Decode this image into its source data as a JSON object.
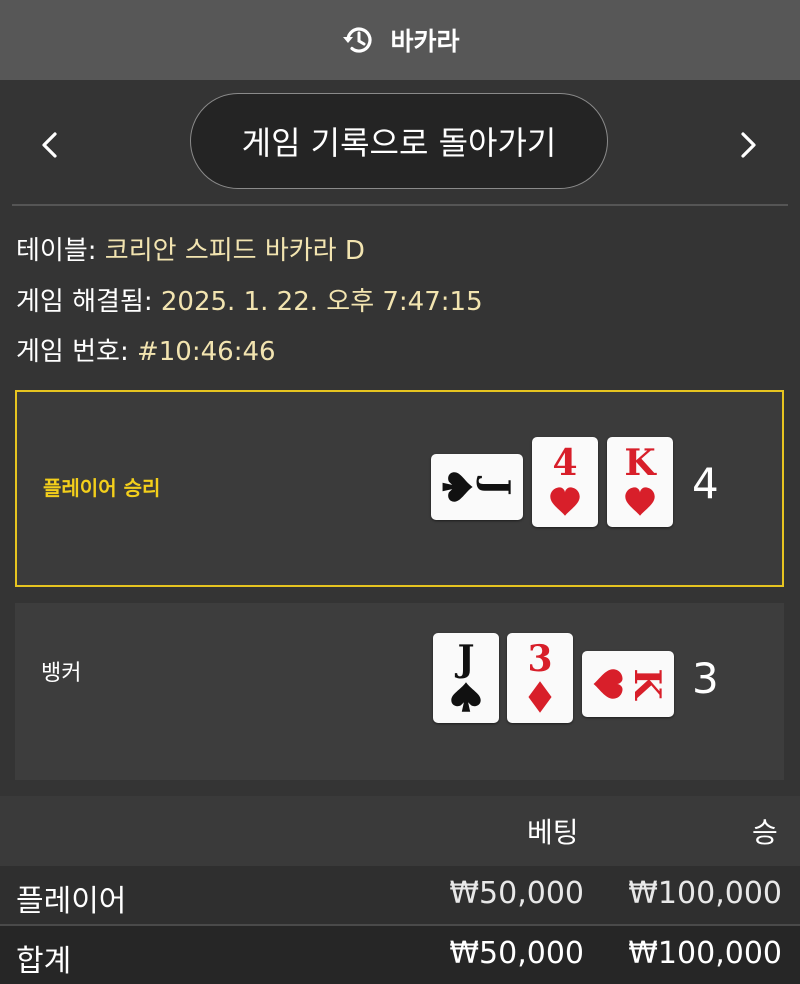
{
  "header": {
    "title": "바카라",
    "icon": "history-icon"
  },
  "nav": {
    "prev_icon": "chevron-left-icon",
    "next_icon": "chevron-right-icon",
    "back_label": "게임 기록으로 돌아가기"
  },
  "info": {
    "table_label": "테이블:",
    "table_value": "코리안 스피드 바카라 D",
    "resolved_label": "게임 해결됨:",
    "resolved_value": "2025. 1. 22. 오후 7:47:15",
    "number_label": "게임 번호:",
    "number_value": "#10:46:46"
  },
  "player": {
    "label": "플레이어 승리",
    "score": "4",
    "cards": [
      {
        "rank": "J",
        "suit": "spade",
        "sideways": true
      },
      {
        "rank": "4",
        "suit": "heart",
        "sideways": false
      },
      {
        "rank": "K",
        "suit": "heart",
        "sideways": false
      }
    ]
  },
  "banker": {
    "label": "뱅커",
    "score": "3",
    "cards": [
      {
        "rank": "J",
        "suit": "spade",
        "sideways": false
      },
      {
        "rank": "3",
        "suit": "diamond",
        "sideways": false
      },
      {
        "rank": "K",
        "suit": "heart",
        "sideways": true
      }
    ]
  },
  "bets": {
    "columns": [
      "베팅",
      "승"
    ],
    "rows": [
      {
        "name": "플레이어",
        "bet": "₩50,000",
        "win": "₩100,000"
      },
      {
        "name": "합계",
        "bet": "₩50,000",
        "win": "₩100,000"
      }
    ]
  },
  "colors": {
    "win_gold": "#f3cf1b",
    "red_suit": "#d81f2a",
    "info_value": "#f2e4b0"
  }
}
